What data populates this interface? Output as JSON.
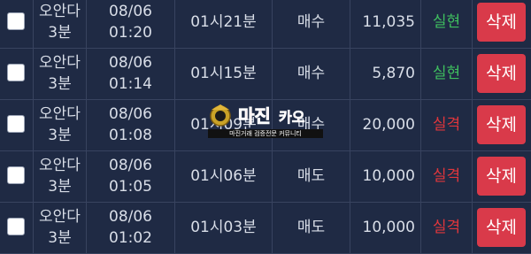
{
  "rows": [
    {
      "type_line1": "오안다",
      "type_line2": "3분",
      "date": "08/06",
      "time": "01:20",
      "target_time": "01시21분",
      "side": "매수",
      "amount": "11,035",
      "status": "실현",
      "status_kind": "win",
      "delete_label": "삭제"
    },
    {
      "type_line1": "오안다",
      "type_line2": "3분",
      "date": "08/06",
      "time": "01:14",
      "target_time": "01시15분",
      "side": "매수",
      "amount": "5,870",
      "status": "실현",
      "status_kind": "win",
      "delete_label": "삭제"
    },
    {
      "type_line1": "오안다",
      "type_line2": "3분",
      "date": "08/06",
      "time": "01:08",
      "target_time": "01시09분",
      "side": "매수",
      "amount": "20,000",
      "status": "실격",
      "status_kind": "loss",
      "delete_label": "삭제"
    },
    {
      "type_line1": "오안다",
      "type_line2": "3분",
      "date": "08/06",
      "time": "01:05",
      "target_time": "01시06분",
      "side": "매도",
      "amount": "10,000",
      "status": "실격",
      "status_kind": "loss",
      "delete_label": "삭제"
    },
    {
      "type_line1": "오안다",
      "type_line2": "3분",
      "date": "08/06",
      "time": "01:02",
      "target_time": "01시03분",
      "side": "매도",
      "amount": "10,000",
      "status": "실격",
      "status_kind": "loss",
      "delete_label": "삭제"
    }
  ],
  "watermark": {
    "brand": "마진",
    "subtitle": "마진거래 검증전문 커뮤니티"
  },
  "colors": {
    "background": "#1f2a44",
    "win": "#3fbf5f",
    "loss": "#e0363c",
    "delete_button": "#d93a4a"
  }
}
